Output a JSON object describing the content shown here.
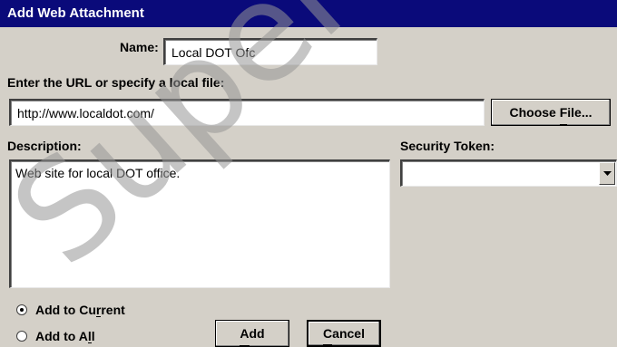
{
  "dialog": {
    "title": "Add Web Attachment",
    "name_label": "Name:",
    "name_value": "Local DOT Ofc",
    "url_prompt": "Enter the URL or specify a local file:",
    "url_value": "http://www.localdot.com/",
    "choose_file_button": {
      "pre": "Choose ",
      "mn": "F",
      "post": "ile..."
    },
    "description_label": "Description:",
    "description_value": "Web site for local DOT office.",
    "security_token_label": "Security Token:",
    "security_token_value": "",
    "radio_options": [
      {
        "pre": "Add to Cu",
        "mn": "r",
        "post": "rent",
        "checked": true
      },
      {
        "pre": "Add to A",
        "mn": "l",
        "post": "l",
        "checked": false
      }
    ],
    "add_button": {
      "pre": "",
      "mn": "A",
      "post": "dd"
    },
    "cancel_button": {
      "pre": "",
      "mn": "C",
      "post": "ancel"
    }
  },
  "watermark": "Superseded",
  "colors": {
    "title_bar": "#0a0a7a",
    "dialog_bg": "#d4d0c8",
    "field_bg": "#ffffff"
  }
}
